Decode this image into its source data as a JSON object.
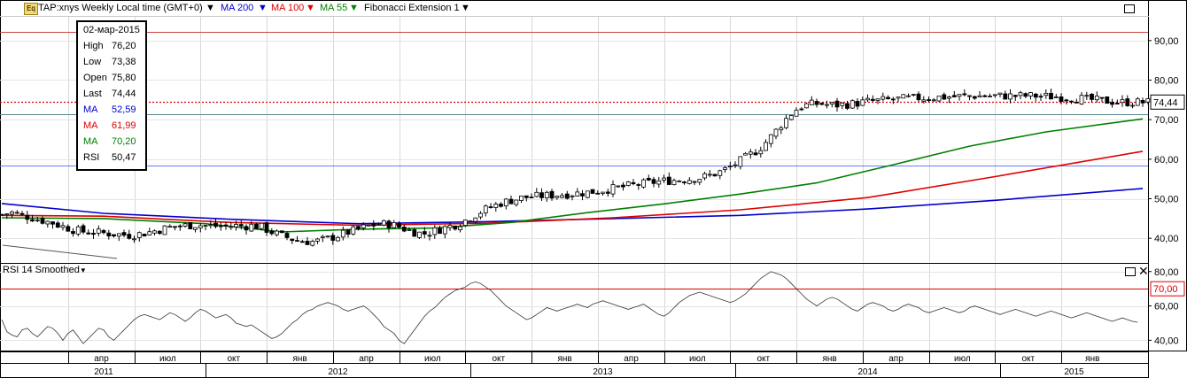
{
  "header": {
    "symbol_text": "TAP:xnys Weekly Local time (GMT+0)",
    "ma200_label": "MA 200",
    "ma100_label": "MA 100",
    "ma55_label": "MA 55",
    "fib_label": "Fibonacci Extension 1",
    "icon": "eq-icon",
    "colors": {
      "ma200": "#0000cc",
      "ma100": "#dd0000",
      "ma55": "#008000"
    }
  },
  "info_box": {
    "date": "02-мар-2015",
    "rows": [
      {
        "key": "High",
        "value": "76,20",
        "color": "#000000"
      },
      {
        "key": "Low",
        "value": "73,38",
        "color": "#000000"
      },
      {
        "key": "Open",
        "value": "75,80",
        "color": "#000000"
      },
      {
        "key": "Last",
        "value": "74,44",
        "color": "#000000"
      },
      {
        "key": "MA",
        "value": "52,59",
        "color": "#0000cc"
      },
      {
        "key": "MA",
        "value": "61,99",
        "color": "#dd0000"
      },
      {
        "key": "MA",
        "value": "70,20",
        "color": "#008000"
      },
      {
        "key": "RSI",
        "value": "50,47",
        "color": "#000000"
      }
    ]
  },
  "rsi_panel": {
    "title": "RSI 14 Smoothed",
    "level_label": "70,00"
  },
  "chart_data": [
    {
      "type": "line",
      "panel": "price",
      "ylim": [
        34,
        96
      ],
      "yticks": [
        40,
        50,
        60,
        70,
        80,
        90
      ],
      "ytick_labels": [
        "40,00",
        "50,00",
        "60,00",
        "70,00",
        "80,00",
        "90,00"
      ],
      "last_price": 74.44,
      "last_price_label": "74,44",
      "last_price_color": "#dd0000",
      "horizontal_lines": [
        {
          "value": 92.2,
          "color": "#cc4444"
        },
        {
          "value": 71.3,
          "color": "#5a8a8a"
        },
        {
          "value": 58.5,
          "color": "#6a7aff"
        }
      ],
      "x_weeks": 225,
      "closes": [
        46,
        46.3,
        46.5,
        46.2,
        45.8,
        45.5,
        45.2,
        44.8,
        44.5,
        44.2,
        43.9,
        43.4,
        43,
        42.6,
        42.2,
        41.9,
        41.7,
        41.6,
        41.5,
        41.4,
        41.3,
        41.2,
        41.1,
        41,
        40.9,
        40.8,
        40.9,
        41.1,
        41.3,
        41.6,
        41.9,
        42.2,
        42.5,
        42.8,
        43,
        43.1,
        43.2,
        43.3,
        43.4,
        43.3,
        43.2,
        43.1,
        43.1,
        43,
        43,
        43.1,
        43.2,
        43.1,
        43.1,
        43.2,
        43.1,
        42.8,
        42.2,
        41.6,
        41.1,
        40.6,
        40.2,
        39.8,
        39.5,
        39.3,
        39.2,
        39.2,
        39.3,
        39.6,
        39.9,
        40.3,
        40.7,
        41.1,
        41.5,
        41.9,
        42.3,
        42.7,
        43.1,
        43.4,
        43.6,
        43.6,
        43.6,
        43.3,
        42.9,
        42.4,
        42,
        41.6,
        41.3,
        41.2,
        41.5,
        41.9,
        42.3,
        42.7,
        43.1,
        43.4,
        43.9,
        44.6,
        45.3,
        46,
        46.7,
        47.3,
        47.9,
        48.4,
        48.9,
        49.3,
        49.6,
        49.9,
        50.2,
        50.4,
        50.5,
        50.6,
        50.7,
        50.8,
        50.9,
        51,
        51.1,
        51.2,
        51.3,
        51.4,
        51.5,
        51.6,
        51.8,
        52,
        52.2,
        52.4,
        52.6,
        52.8,
        53,
        53.2,
        53.4,
        53.6,
        53.8,
        54,
        54.2,
        54.4,
        54.5,
        54.6,
        54.7,
        54.8,
        54.9,
        55,
        55.1,
        55.3,
        55.6,
        55.9,
        56.3,
        56.8,
        57.4,
        58.1,
        58.8,
        59.6,
        60.4,
        61.2,
        62,
        63,
        64.3,
        65.7,
        67.2,
        68.8,
        70.2,
        71.5,
        72.6,
        73.3,
        73.7,
        73.9,
        74,
        74,
        73.8,
        73.7,
        73.7,
        73.8,
        73.9,
        74,
        74.2,
        74.4,
        74.6,
        74.7,
        74.8,
        74.9,
        75,
        75.1,
        75.2,
        75.3,
        75.4,
        75.4,
        75.5,
        75.5,
        75.6,
        75.6,
        75.7,
        75.7,
        75.8,
        75.8,
        75.9,
        75.9,
        75.9,
        76,
        76,
        76,
        76,
        76,
        76,
        76,
        76,
        76,
        76,
        76,
        76,
        76,
        75.9,
        75.9,
        75.8,
        75.8,
        75.7,
        75.6,
        75.5,
        75.4,
        75.3,
        75.1,
        75,
        74.9,
        74.8,
        74.7,
        74.6,
        74.5,
        74.4,
        74.4,
        74.4,
        74.4,
        74.4,
        74.4,
        74.4,
        74.44
      ],
      "series": [
        {
          "name": "MA 200",
          "color": "#0000cc",
          "points": [
            [
              0,
              48.8
            ],
            [
              20,
              46.3
            ],
            [
              45,
              44.8
            ],
            [
              70,
              43.7
            ],
            [
              95,
              44.2
            ],
            [
              120,
              45
            ],
            [
              145,
              45.8
            ],
            [
              170,
              47.4
            ],
            [
              195,
              49.6
            ],
            [
              224,
              52.6
            ]
          ]
        },
        {
          "name": "MA 100",
          "color": "#dd0000",
          "points": [
            [
              0,
              45.8
            ],
            [
              20,
              45.6
            ],
            [
              45,
              44
            ],
            [
              70,
              43.3
            ],
            [
              95,
              43.8
            ],
            [
              120,
              45.2
            ],
            [
              145,
              47.2
            ],
            [
              170,
              50.3
            ],
            [
              195,
              55.6
            ],
            [
              224,
              62
            ]
          ]
        },
        {
          "name": "MA 55",
          "color": "#008000",
          "points": [
            [
              0,
              45.2
            ],
            [
              20,
              45
            ],
            [
              40,
              43.7
            ],
            [
              55,
              41.6
            ],
            [
              70,
              42.3
            ],
            [
              85,
              42.6
            ],
            [
              100,
              44
            ],
            [
              115,
              46.5
            ],
            [
              130,
              48.7
            ],
            [
              145,
              51.2
            ],
            [
              160,
              54
            ],
            [
              175,
              58.6
            ],
            [
              190,
              63.3
            ],
            [
              205,
              66.9
            ],
            [
              224,
              70.2
            ]
          ]
        }
      ]
    },
    {
      "type": "line",
      "panel": "rsi",
      "name": "RSI 14 Smoothed",
      "ylim": [
        34,
        84
      ],
      "yticks": [
        40,
        60,
        80
      ],
      "ytick_labels": [
        "40,00",
        "60,00",
        "80,00"
      ],
      "levels": [
        70,
        30
      ],
      "values": [
        52,
        45,
        43,
        42,
        46,
        47,
        44,
        42,
        45,
        48,
        47,
        44,
        40,
        44,
        46,
        42,
        38,
        41,
        44,
        47,
        46,
        42,
        40,
        43,
        46,
        49,
        52,
        54,
        55,
        54,
        53,
        52,
        54,
        56,
        55,
        53,
        51,
        53,
        56,
        58,
        57,
        55,
        53,
        54,
        55,
        53,
        50,
        49,
        48,
        49,
        47,
        45,
        43,
        41,
        42,
        44,
        47,
        50,
        52,
        55,
        57,
        58,
        60,
        61,
        62,
        61,
        60,
        58,
        57,
        58,
        59,
        60,
        58,
        55,
        52,
        48,
        46,
        44,
        40,
        38,
        42,
        46,
        50,
        54,
        57,
        59,
        62,
        65,
        67,
        69,
        70,
        71,
        73,
        74,
        73,
        71,
        69,
        66,
        63,
        60,
        58,
        56,
        54,
        52,
        53,
        55,
        57,
        59,
        58,
        57,
        58,
        59,
        60,
        61,
        60,
        59,
        61,
        62,
        63,
        62,
        61,
        60,
        59,
        58,
        59,
        60,
        61,
        59,
        57,
        55,
        54,
        56,
        59,
        62,
        64,
        66,
        67,
        68,
        67,
        66,
        65,
        64,
        63,
        62,
        63,
        65,
        67,
        70,
        73,
        76,
        78,
        80,
        79,
        78,
        76,
        73,
        70,
        67,
        64,
        62,
        60,
        62,
        64,
        65,
        64,
        62,
        60,
        58,
        57,
        59,
        61,
        62,
        61,
        60,
        58,
        57,
        58,
        60,
        61,
        60,
        59,
        57,
        56,
        57,
        58,
        59,
        58,
        57,
        56,
        57,
        59,
        60,
        59,
        58,
        57,
        56,
        55,
        56,
        57,
        58,
        57,
        56,
        55,
        54,
        55,
        56,
        57,
        56,
        55,
        54,
        53,
        54,
        55,
        56,
        55,
        54,
        53,
        52,
        51,
        52,
        53,
        52,
        51,
        50.47
      ]
    }
  ],
  "x_axis": {
    "months": [
      "апр",
      "июл",
      "окт",
      "янв",
      "апр",
      "июл",
      "окт",
      "янв",
      "апр",
      "июл",
      "окт",
      "янв",
      "апр",
      "июл",
      "окт",
      "янв"
    ],
    "month_weeks": [
      13,
      26,
      39,
      52,
      65,
      78,
      91,
      104,
      117,
      130,
      143,
      156,
      169,
      182,
      195,
      208
    ],
    "years": [
      "2011",
      "2012",
      "2013",
      "2014",
      "2015"
    ],
    "year_boundaries": [
      0,
      40,
      92,
      144,
      196,
      210,
      225
    ]
  }
}
